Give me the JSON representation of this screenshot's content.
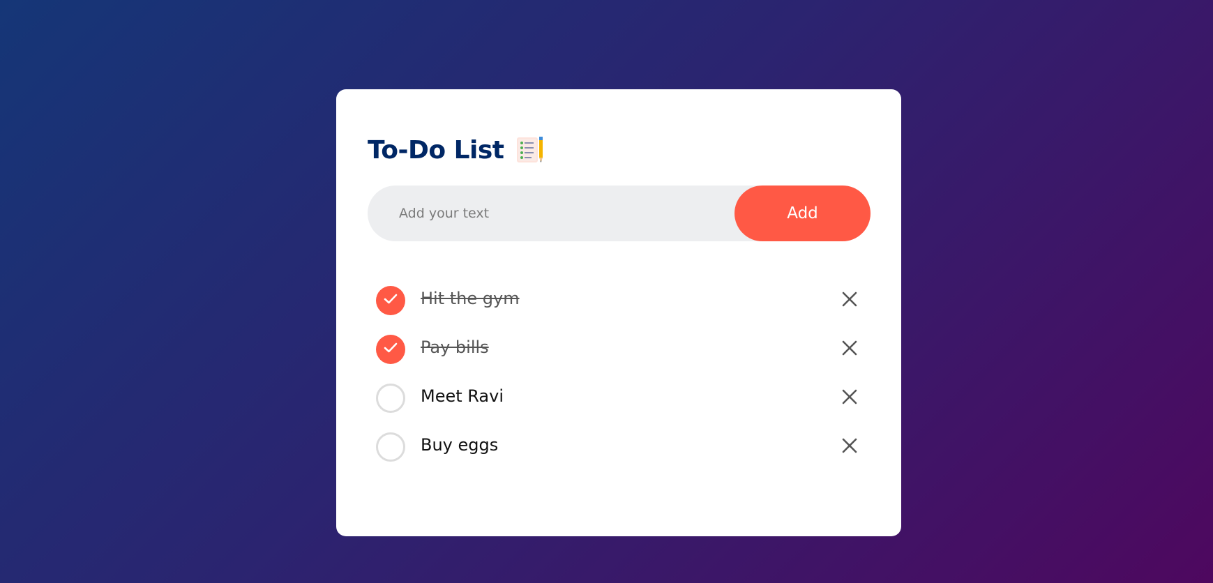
{
  "app": {
    "title": "To-Do List",
    "title_icon": "notepad-checklist-icon"
  },
  "input": {
    "placeholder": "Add your text",
    "value": "",
    "add_label": "Add"
  },
  "tasks": [
    {
      "text": "Hit the gym",
      "checked": true
    },
    {
      "text": "Pay bills",
      "checked": true
    },
    {
      "text": "Meet Ravi",
      "checked": false
    },
    {
      "text": "Buy eggs",
      "checked": false
    }
  ],
  "icons": {
    "check": "check-icon",
    "delete": "close-icon"
  },
  "colors": {
    "accent": "#ff5945",
    "title": "#002765",
    "input_bg": "#edeef0",
    "bg_start": "#153677",
    "bg_end": "#4e085f"
  }
}
